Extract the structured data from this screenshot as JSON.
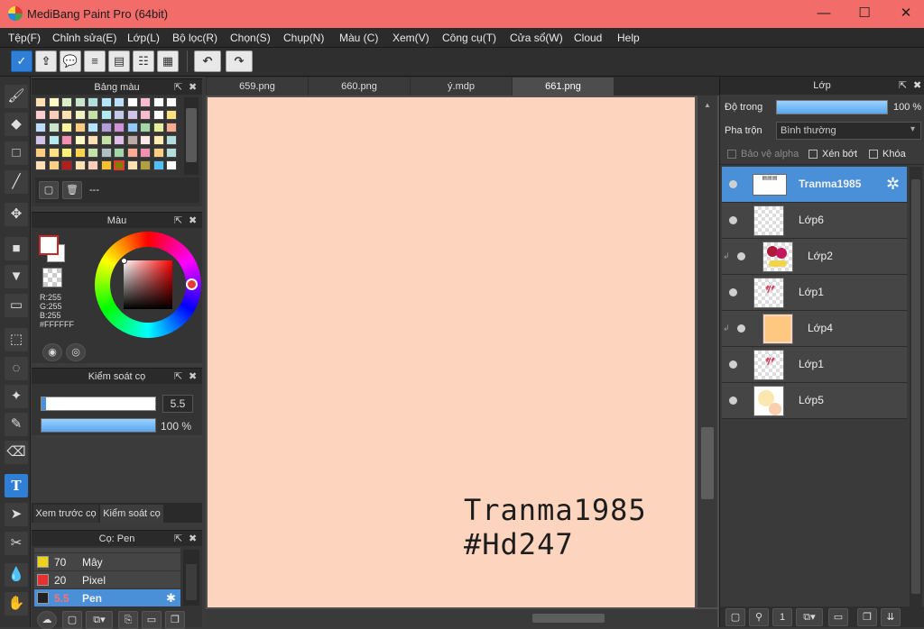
{
  "window": {
    "title": "MediBang Paint Pro (64bit)",
    "minimize": "—",
    "maximize": "☐",
    "close": "✕"
  },
  "menu": [
    "Tệp(F)",
    "Chỉnh sửa(E)",
    "Lớp(L)",
    "Bộ lọc(R)",
    "Chọn(S)",
    "Chụp(N)",
    "Màu (C)",
    "Xem(V)",
    "Công cụ(T)",
    "Cửa sổ(W)",
    "Cloud",
    "Help"
  ],
  "file_tabs": [
    "659.png",
    "660.png",
    "ý.mdp",
    "661.png"
  ],
  "palette_panel": {
    "title": "Bảng màu",
    "entry_text": "---"
  },
  "color_panel": {
    "title": "Màu",
    "r": "R:255",
    "g": "G:255",
    "b": "B:255",
    "hex": "#FFFFFF",
    "main_color": "#ffffff",
    "sub_color": "#ffffff"
  },
  "brush_control": {
    "title": "Kiểm soát cọ",
    "size": "5.5",
    "opacity": "100 %",
    "size_fraction": 0.04,
    "opacity_fraction": 1.0
  },
  "bottom_tabs": [
    "Xem trước cọ",
    "Kiểm soát cọ"
  ],
  "brush_list": {
    "title": "Cọ: Pen",
    "items": [
      {
        "size": "70",
        "name": "Mây",
        "color": "#ecd21b"
      },
      {
        "size": "20",
        "name": "Pixel",
        "color": "#e83030"
      },
      {
        "size": "5.5",
        "name": "Pen",
        "color": "#222222"
      }
    ]
  },
  "canvas": {
    "background": "#fdd5bf",
    "watermark_line1": "Tranma1985",
    "watermark_line2": "#Hd247"
  },
  "layer_panel": {
    "title": "Lớp",
    "opacity_label": "Độ trong",
    "opacity_value": "100 %",
    "blend_label": "Pha trộn",
    "blend_value": "Bình thường",
    "alpha_protect": "Bảo vệ alpha",
    "clipping": "Xén bớt",
    "lock": "Khóa",
    "layers": [
      {
        "name": "Tranma1985",
        "selected": true
      },
      {
        "name": "Lớp6"
      },
      {
        "name": "Lớp2"
      },
      {
        "name": "Lớp1"
      },
      {
        "name": "Lớp4"
      },
      {
        "name": "Lớp1"
      },
      {
        "name": "Lớp5"
      }
    ]
  },
  "accent_color": "#4a90d9"
}
